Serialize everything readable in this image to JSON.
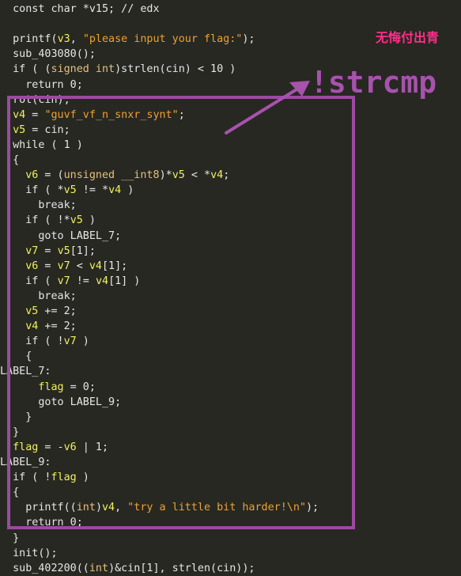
{
  "code_lines": [
    [
      {
        "t": "  const char *v15; // edx",
        "c": "plain"
      }
    ],
    [
      {
        "t": "",
        "c": "plain"
      }
    ],
    [
      {
        "t": "  printf(",
        "c": "plain"
      },
      {
        "t": "v3",
        "c": "var"
      },
      {
        "t": ", ",
        "c": "plain"
      },
      {
        "t": "\"please input your flag:\"",
        "c": "str"
      },
      {
        "t": ");",
        "c": "plain"
      }
    ],
    [
      {
        "t": "  sub_403080();",
        "c": "plain"
      }
    ],
    [
      {
        "t": "  if ( (",
        "c": "plain"
      },
      {
        "t": "signed int",
        "c": "kw"
      },
      {
        "t": ")strlen(cin) < 10 )",
        "c": "plain"
      }
    ],
    [
      {
        "t": "    return 0;",
        "c": "plain"
      }
    ],
    [
      {
        "t": "  rot(cin);",
        "c": "plain"
      }
    ],
    [
      {
        "t": "  ",
        "c": "plain"
      },
      {
        "t": "v4",
        "c": "var"
      },
      {
        "t": " = ",
        "c": "plain"
      },
      {
        "t": "\"guvf_vf_n_snxr_synt\"",
        "c": "str"
      },
      {
        "t": ";",
        "c": "plain"
      }
    ],
    [
      {
        "t": "  ",
        "c": "plain"
      },
      {
        "t": "v5",
        "c": "var"
      },
      {
        "t": " = cin;",
        "c": "plain"
      }
    ],
    [
      {
        "t": "  while ( 1 )",
        "c": "plain"
      }
    ],
    [
      {
        "t": "  {",
        "c": "plain"
      }
    ],
    [
      {
        "t": "    ",
        "c": "plain"
      },
      {
        "t": "v6",
        "c": "var"
      },
      {
        "t": " = (",
        "c": "plain"
      },
      {
        "t": "unsigned __int8",
        "c": "kw"
      },
      {
        "t": ")*",
        "c": "plain"
      },
      {
        "t": "v5",
        "c": "var"
      },
      {
        "t": " < *",
        "c": "plain"
      },
      {
        "t": "v4",
        "c": "var"
      },
      {
        "t": ";",
        "c": "plain"
      }
    ],
    [
      {
        "t": "    if ( *",
        "c": "plain"
      },
      {
        "t": "v5",
        "c": "var"
      },
      {
        "t": " != *",
        "c": "plain"
      },
      {
        "t": "v4",
        "c": "var"
      },
      {
        "t": " )",
        "c": "plain"
      }
    ],
    [
      {
        "t": "      break;",
        "c": "plain"
      }
    ],
    [
      {
        "t": "    if ( !*",
        "c": "plain"
      },
      {
        "t": "v5",
        "c": "var"
      },
      {
        "t": " )",
        "c": "plain"
      }
    ],
    [
      {
        "t": "      goto LABEL_7;",
        "c": "plain"
      }
    ],
    [
      {
        "t": "    ",
        "c": "plain"
      },
      {
        "t": "v7",
        "c": "var"
      },
      {
        "t": " = ",
        "c": "plain"
      },
      {
        "t": "v5",
        "c": "var"
      },
      {
        "t": "[1];",
        "c": "plain"
      }
    ],
    [
      {
        "t": "    ",
        "c": "plain"
      },
      {
        "t": "v6",
        "c": "var"
      },
      {
        "t": " = ",
        "c": "plain"
      },
      {
        "t": "v7",
        "c": "var"
      },
      {
        "t": " < ",
        "c": "plain"
      },
      {
        "t": "v4",
        "c": "var"
      },
      {
        "t": "[1];",
        "c": "plain"
      }
    ],
    [
      {
        "t": "    if ( ",
        "c": "plain"
      },
      {
        "t": "v7",
        "c": "var"
      },
      {
        "t": " != ",
        "c": "plain"
      },
      {
        "t": "v4",
        "c": "var"
      },
      {
        "t": "[1] )",
        "c": "plain"
      }
    ],
    [
      {
        "t": "      break;",
        "c": "plain"
      }
    ],
    [
      {
        "t": "    ",
        "c": "plain"
      },
      {
        "t": "v5",
        "c": "var"
      },
      {
        "t": " += 2;",
        "c": "plain"
      }
    ],
    [
      {
        "t": "    ",
        "c": "plain"
      },
      {
        "t": "v4",
        "c": "var"
      },
      {
        "t": " += 2;",
        "c": "plain"
      }
    ],
    [
      {
        "t": "    if ( !",
        "c": "plain"
      },
      {
        "t": "v7",
        "c": "var"
      },
      {
        "t": " )",
        "c": "plain"
      }
    ],
    [
      {
        "t": "    {",
        "c": "plain"
      }
    ],
    [
      {
        "t": "LABEL_7:",
        "c": "plain"
      }
    ],
    [
      {
        "t": "      ",
        "c": "plain"
      },
      {
        "t": "flag",
        "c": "var"
      },
      {
        "t": " = 0;",
        "c": "plain"
      }
    ],
    [
      {
        "t": "      goto LABEL_9;",
        "c": "plain"
      }
    ],
    [
      {
        "t": "    }",
        "c": "plain"
      }
    ],
    [
      {
        "t": "  }",
        "c": "plain"
      }
    ],
    [
      {
        "t": "  ",
        "c": "plain"
      },
      {
        "t": "flag",
        "c": "var"
      },
      {
        "t": " = -",
        "c": "plain"
      },
      {
        "t": "v6",
        "c": "var"
      },
      {
        "t": " | 1;",
        "c": "plain"
      }
    ],
    [
      {
        "t": "LABEL_9:",
        "c": "plain"
      }
    ],
    [
      {
        "t": "  if ( !",
        "c": "plain"
      },
      {
        "t": "flag",
        "c": "var"
      },
      {
        "t": " )",
        "c": "plain"
      }
    ],
    [
      {
        "t": "  {",
        "c": "plain"
      }
    ],
    [
      {
        "t": "    printf((",
        "c": "plain"
      },
      {
        "t": "int",
        "c": "kw"
      },
      {
        "t": ")",
        "c": "plain"
      },
      {
        "t": "v4",
        "c": "var"
      },
      {
        "t": ", ",
        "c": "plain"
      },
      {
        "t": "\"try a little bit harder!\\n\"",
        "c": "str"
      },
      {
        "t": ");",
        "c": "plain"
      }
    ],
    [
      {
        "t": "    return 0;",
        "c": "plain"
      }
    ],
    [
      {
        "t": "  }",
        "c": "plain"
      }
    ],
    [
      {
        "t": "  init();",
        "c": "plain"
      }
    ],
    [
      {
        "t": "  sub_402200((",
        "c": "plain"
      },
      {
        "t": "int",
        "c": "kw"
      },
      {
        "t": ")&cin[1], strlen(cin));",
        "c": "plain"
      }
    ]
  ],
  "annotation": {
    "label": "!strcmp",
    "color": "#a752ad"
  },
  "watermark": {
    "text": "无悔付出青",
    "color": "#ff2d8a"
  },
  "colors": {
    "background": "#272822",
    "plain": "#e6e6e6",
    "keyword": "#e5c07b",
    "variable": "#f1f15b",
    "string": "#f0a030",
    "box": "#9c4aa0"
  }
}
